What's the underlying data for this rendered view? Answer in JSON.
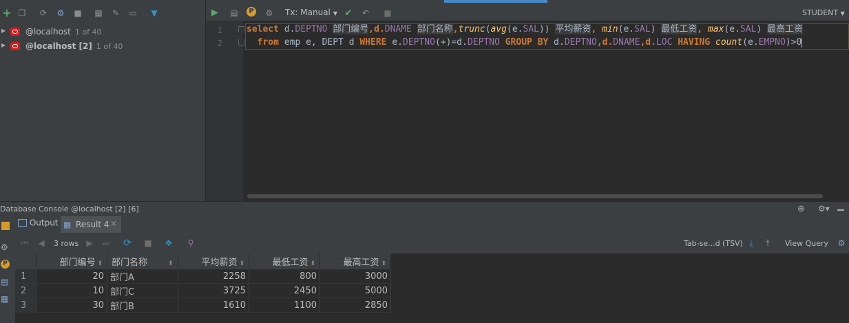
{
  "datasources": [
    {
      "name": "@localhost",
      "count": "1 of 40",
      "bold": false
    },
    {
      "name": "@localhost [2]",
      "count": "1 of 40",
      "bold": true
    }
  ],
  "editor_toolbar": {
    "tx_mode": "Tx: Manual",
    "schema": "STUDENT"
  },
  "editor": {
    "line_numbers": [
      "1",
      "2"
    ],
    "line1": {
      "t1": "select",
      "t2": " d.",
      "t3": "DEPTNO",
      "t4": " ",
      "t5": "部门编号",
      "t6": ",d.",
      "t7": "DNAME",
      "t8": " ",
      "t9": "部门名称",
      "t10": ",",
      "t11": "trunc",
      "t12": "(",
      "t13": "avg",
      "t14": "(e.",
      "t15": "SAL",
      "t16": ")) ",
      "t17": "平均薪资",
      "t18": ", ",
      "t19": "min",
      "t20": "(e.",
      "t21": "SAL",
      "t22": ") ",
      "t23": "最低工资",
      "t24": ", ",
      "t25": "max",
      "t26": "(e.",
      "t27": "SAL",
      "t28": ") ",
      "t29": "最高工资"
    },
    "line2": {
      "t1": "  from",
      "t2": " emp e, DEPT d ",
      "t3": "WHERE",
      "t4": " e.",
      "t5": "DEPTNO",
      "t6": "(+)=d.",
      "t7": "DEPTNO",
      "t8": " ",
      "t9": "GROUP BY",
      "t10": " d.",
      "t11": "DEPTNO",
      "t12": ",d.",
      "t13": "DNAME",
      "t14": ",d.",
      "t15": "LOC",
      "t16": " ",
      "t17": "HAVING",
      "t18": " ",
      "t19": "count",
      "t20": "(e.",
      "t21": "EMPNO",
      "t22": ")>0"
    }
  },
  "console": {
    "title": "Database Console @localhost [2] [6]"
  },
  "tabs": [
    {
      "label": "Output"
    },
    {
      "label": "Result 4"
    }
  ],
  "grid_toolbar": {
    "rows": "3 rows",
    "export_format": "Tab-se...d (TSV)",
    "view_query": "View Query"
  },
  "table": {
    "columns": [
      "部门编号",
      "部门名称",
      "平均薪资",
      "最低工资",
      "最高工资"
    ],
    "rows": [
      {
        "n": "1",
        "c": [
          "20",
          "部门A",
          "2258",
          "800",
          "3000"
        ]
      },
      {
        "n": "2",
        "c": [
          "10",
          "部门C",
          "3725",
          "2450",
          "5000"
        ]
      },
      {
        "n": "3",
        "c": [
          "30",
          "部门B",
          "1610",
          "1100",
          "2850"
        ]
      }
    ]
  },
  "colors": {
    "accent": "#4a88c7",
    "keyword": "#cc7832",
    "function": "#ffc66d",
    "column": "#9876aa",
    "oracle_red": "#d21f1f",
    "run_green": "#4caf50"
  }
}
